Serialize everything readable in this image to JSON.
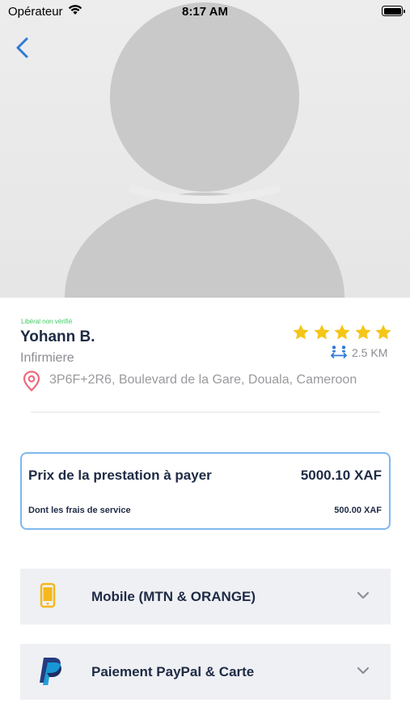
{
  "status_bar": {
    "carrier": "Opérateur",
    "time": "8:17 AM"
  },
  "profile": {
    "badge": "Libéral non vérifié",
    "name": "Yohann B.",
    "profession": "Infirmiere",
    "address": "3P6F+2R6, Boulevard de la Gare, Douala, Cameroon",
    "rating": 5,
    "rating_max": 5,
    "distance": "2.5 KM"
  },
  "price": {
    "label": "Prix de la prestation à payer",
    "value": "5000.10 XAF",
    "fee_label": "Dont les frais de service",
    "fee_value": "500.00 XAF"
  },
  "payment_options": [
    {
      "label": "Mobile (MTN & ORANGE)",
      "icon": "mobile-phone-icon"
    },
    {
      "label": "Paiement PayPal & Carte",
      "icon": "paypal-icon"
    }
  ],
  "colors": {
    "accent_blue": "#2f7ad6",
    "verified_green": "#3ccd5d",
    "star_gold": "#f5c518",
    "pin_pink": "#ef6a7e",
    "card_border": "#7fb8ee",
    "text_dark": "#1e2b45"
  }
}
